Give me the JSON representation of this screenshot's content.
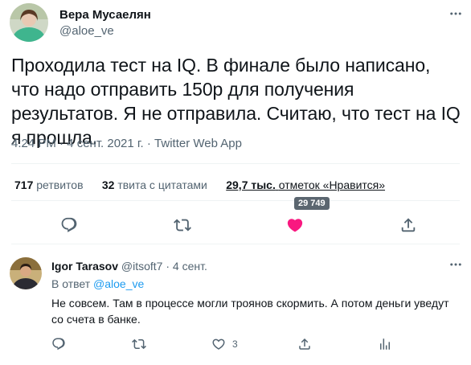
{
  "main_tweet": {
    "author_name": "Вера Мусаелян",
    "author_handle": "@aloe_ve",
    "text": "Проходила тест на IQ. В финале было написано, что надо отправить 150р для получения результатов. Я не отправила. Считаю, что тест на IQ я прошла.",
    "meta": "4:24 PM · 4 сент. 2021 г. · Twitter Web App",
    "stats": {
      "retweets_count": "717",
      "retweets_label": "ретвитов",
      "quotes_count": "32",
      "quotes_label": "твита с цитатами",
      "likes_count": "29,7 тыс.",
      "likes_label": "отметок «Нравится»"
    },
    "likes_tooltip": "29 749",
    "actions": [
      "reply-icon",
      "retweet-icon",
      "like-icon",
      "share-icon"
    ],
    "like_color": "#f91880"
  },
  "reply": {
    "author_name": "Igor Tarasov",
    "author_handle": "@itsoft7",
    "separator": "·",
    "date": "4 сент.",
    "reply_to_label": "В ответ",
    "reply_to_handle": "@aloe_ve",
    "text": "Не совсем. Там в процессе могли троянов скормить. А потом деньги уведут со счета в банке.",
    "likes_count": "3",
    "actions": [
      "reply-icon",
      "retweet-icon",
      "like-icon",
      "share-icon",
      "analytics-icon"
    ]
  },
  "colors": {
    "accent": "#1d9bf0",
    "muted": "#536471",
    "text": "#0f1419"
  }
}
